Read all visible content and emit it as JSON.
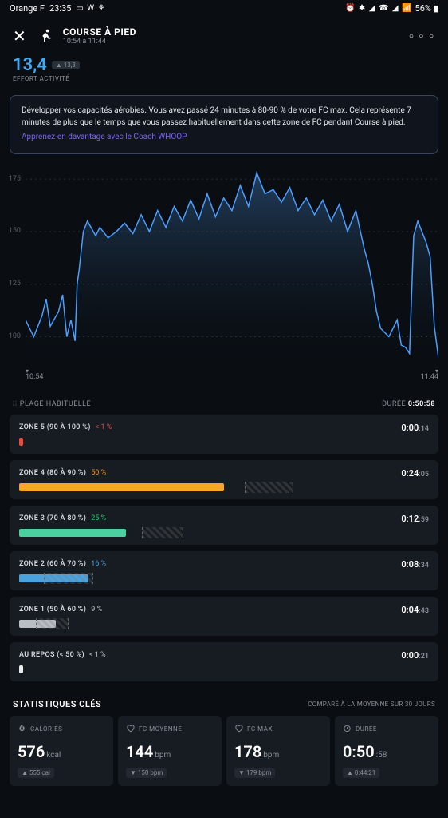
{
  "status": {
    "carrier": "Orange F",
    "time": "23:35",
    "battery": "56%"
  },
  "header": {
    "title": "COURSE À PIED",
    "time_range": "10:54 à 11:44"
  },
  "effort": {
    "value": "13,4",
    "trend": "▲ 13,3",
    "label": "EFFORT ACTIVITÉ"
  },
  "info": {
    "text": "Développer vos capacités aérobies. Vous avez passé 24 minutes à 80-90 % de votre FC max. Cela représente 7 minutes de plus que le temps que vous passez habituellement dans cette zone de FC pendant Course à pied.",
    "link": "Apprenez-en davantage avec le Coach WHOOP"
  },
  "chart_data": {
    "type": "line",
    "title": "",
    "xlabel": "",
    "ylabel": "",
    "ylim": [
      85,
      180
    ],
    "y_ticks": [
      100,
      125,
      150,
      175
    ],
    "x_ticks": [
      "10:54",
      "11:44"
    ],
    "x": [
      0,
      2,
      4,
      5,
      6,
      8,
      9,
      10,
      11,
      12,
      12.5,
      13,
      14,
      15,
      17,
      18,
      20,
      22,
      24,
      26,
      28,
      30,
      32,
      34,
      36,
      38,
      40,
      42,
      44,
      46,
      48,
      50,
      52,
      54,
      56,
      58,
      60,
      62,
      64,
      66,
      68,
      70,
      72,
      74,
      76,
      78,
      80,
      82,
      83,
      84,
      85,
      86,
      88,
      90,
      91,
      92,
      93,
      94,
      95,
      96,
      97,
      98,
      99,
      100
    ],
    "y": [
      108,
      100,
      110,
      118,
      105,
      112,
      120,
      100,
      108,
      98,
      125,
      132,
      150,
      155,
      148,
      152,
      147,
      150,
      154,
      149,
      158,
      150,
      160,
      152,
      162,
      155,
      165,
      156,
      168,
      157,
      166,
      160,
      172,
      162,
      178,
      168,
      170,
      164,
      171,
      160,
      166,
      158,
      165,
      155,
      163,
      150,
      160,
      142,
      135,
      125,
      112,
      104,
      100,
      108,
      96,
      95,
      92,
      148,
      155,
      150,
      145,
      138,
      105,
      90
    ]
  },
  "zones_header": {
    "label": "PLAGE HABITUELLE",
    "duration_label": "DURÉE",
    "duration_value": "0:50:58"
  },
  "zones": [
    {
      "name": "ZONE 5 (90 À 100 %)",
      "pct": "< 1 %",
      "pct_color": "#e84c3d",
      "time": "0:00",
      "sec": ":14",
      "fill": 1,
      "color": "#e84c3d",
      "hab_start": null,
      "hab_width": null
    },
    {
      "name": "ZONE 4 (80 À 90 %)",
      "pct": "50 %",
      "pct_color": "#f39c12",
      "time": "0:24",
      "sec": ":05",
      "fill": 50,
      "color": "#f5a623",
      "hab_start": 55,
      "hab_width": 12
    },
    {
      "name": "ZONE 3 (70 À 80 %)",
      "pct": "25 %",
      "pct_color": "#2ecc71",
      "time": "0:12",
      "sec": ":59",
      "fill": 26,
      "color": "#4bd0a0",
      "hab_start": 30,
      "hab_width": 10
    },
    {
      "name": "ZONE 2 (60 À 70 %)",
      "pct": "16 %",
      "pct_color": "#4aa3df",
      "time": "0:08",
      "sec": ":34",
      "fill": 17,
      "color": "#4aa3df",
      "hab_start": 6,
      "hab_width": 12
    },
    {
      "name": "ZONE 1 (50 À 60 %)",
      "pct": "9 %",
      "pct_color": "#bdc3c7",
      "time": "0:04",
      "sec": ":43",
      "fill": 9,
      "color": "#b8bec4",
      "hab_start": 4,
      "hab_width": 8
    },
    {
      "name": "AU REPOS (< 50 %)",
      "pct": "< 1 %",
      "pct_color": "#bdc3c7",
      "time": "0:00",
      "sec": ":21",
      "fill": 1,
      "color": "#e8eaec",
      "hab_start": null,
      "hab_width": null
    }
  ],
  "stats_header": {
    "title": "STATISTIQUES CLÉS",
    "sub": "COMPARÉ À LA MOYENNE SUR 30 JOURS"
  },
  "stats": [
    {
      "icon": "flame",
      "label": "CALORIES",
      "value": "576",
      "unit": "kcal",
      "trend": "▲ 555 cal"
    },
    {
      "icon": "heart",
      "label": "FC MOYENNE",
      "value": "144",
      "unit": "bpm",
      "trend": "▼ 150 bpm"
    },
    {
      "icon": "heart",
      "label": "FC MAX",
      "value": "178",
      "unit": "bpm",
      "trend": "▼ 179 bpm"
    },
    {
      "icon": "clock",
      "label": "DURÉE",
      "value": "0:50",
      "unit": ":58",
      "trend": "▲ 0:44:21"
    }
  ]
}
